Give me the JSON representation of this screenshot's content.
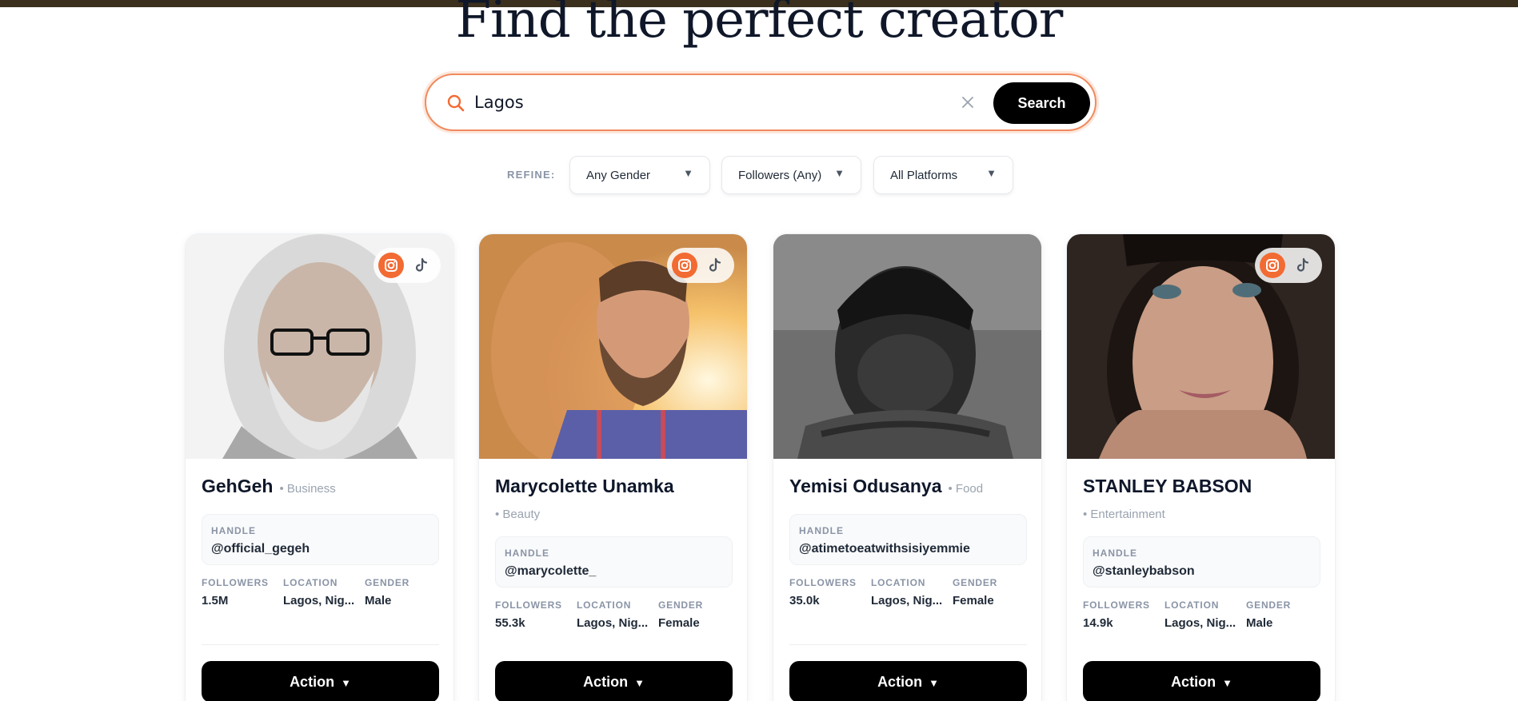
{
  "hero": {
    "title": "Find the perfect creator"
  },
  "search": {
    "value": "Lagos",
    "placeholder": "",
    "button_label": "Search"
  },
  "refine": {
    "label": "REFINE:",
    "filters": [
      {
        "label": "Any Gender"
      },
      {
        "label": "Followers (Any)"
      },
      {
        "label": "All Platforms"
      }
    ]
  },
  "labels": {
    "handle": "HANDLE",
    "followers": "FOLLOWERS",
    "location": "LOCATION",
    "gender": "GENDER",
    "action": "Action"
  },
  "creators": [
    {
      "name": "GehGeh",
      "category": "• Business",
      "handle": "@official_gegeh",
      "followers": "1.5M",
      "location": "Lagos, Nig...",
      "gender": "Male",
      "platforms": [
        "instagram",
        "tiktok"
      ]
    },
    {
      "name": "Marycolette Unamka",
      "category": "• Beauty",
      "handle": "@marycolette_",
      "followers": "55.3k",
      "location": "Lagos, Nig...",
      "gender": "Female",
      "platforms": [
        "instagram",
        "tiktok"
      ]
    },
    {
      "name": "Yemisi Odusanya",
      "category": "• Food",
      "handle": "@atimetoeatwithsisiyemmie",
      "followers": "35.0k",
      "location": "Lagos, Nig...",
      "gender": "Female",
      "platforms": []
    },
    {
      "name": "STANLEY BABSON",
      "category": "• Entertainment",
      "handle": "@stanleybabson",
      "followers": "14.9k",
      "location": "Lagos, Nig...",
      "gender": "Male",
      "platforms": [
        "instagram",
        "tiktok"
      ]
    }
  ],
  "colors": {
    "accent": "#f26b33",
    "top_bar": "#3b2f1e",
    "button": "#000000"
  },
  "icons": [
    "search-icon",
    "clear-icon",
    "chevron-down-icon",
    "instagram-icon",
    "tiktok-icon"
  ]
}
